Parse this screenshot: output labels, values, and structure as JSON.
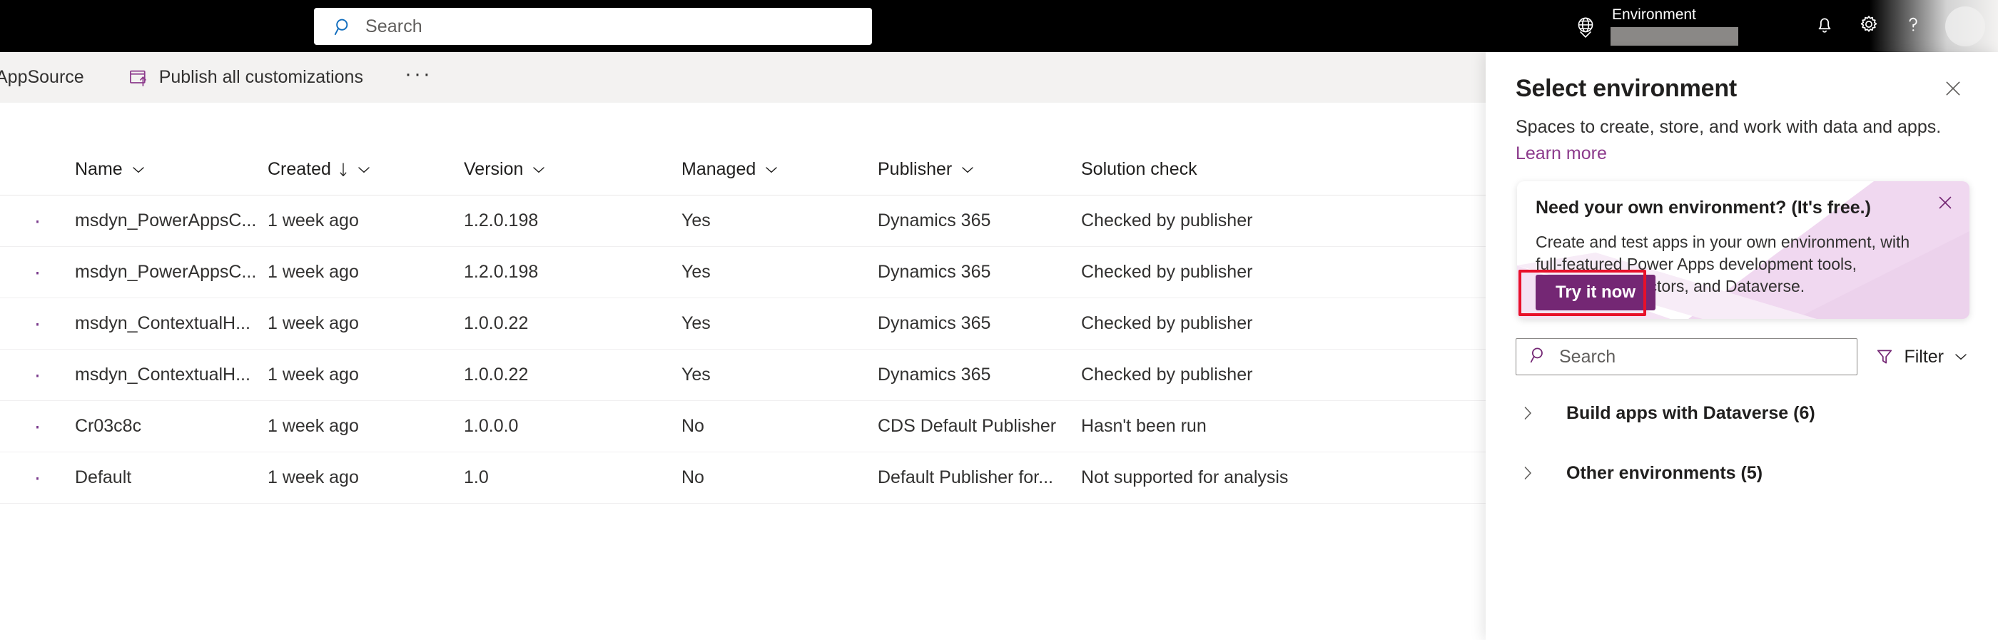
{
  "topbar": {
    "search_placeholder": "Search",
    "search_icon": "search-icon",
    "globe_icon": "globe-icon",
    "environment_label": "Environment",
    "environment_value": "",
    "notifications_icon": "bell-icon",
    "settings_icon": "gear-icon",
    "help_icon": "question-mark-icon",
    "avatar": "user-avatar"
  },
  "commandbar": {
    "appsource_label": "AppSource",
    "publish_label": "Publish all customizations",
    "publish_icon": "publish-icon",
    "overflow_label": "···"
  },
  "table": {
    "columns": [
      {
        "key": "name",
        "label": "Name",
        "chevron": true,
        "sorted": false
      },
      {
        "key": "created",
        "label": "Created",
        "chevron": true,
        "sorted": true,
        "sort_dir": "desc"
      },
      {
        "key": "version",
        "label": "Version",
        "chevron": true,
        "sorted": false
      },
      {
        "key": "managed",
        "label": "Managed",
        "chevron": true,
        "sorted": false
      },
      {
        "key": "publisher",
        "label": "Publisher",
        "chevron": true,
        "sorted": false
      },
      {
        "key": "solution_check",
        "label": "Solution check",
        "chevron": false,
        "sorted": false
      }
    ],
    "rows": [
      {
        "name": "msdyn_PowerAppsC...",
        "created": "1 week ago",
        "version": "1.2.0.198",
        "managed": "Yes",
        "publisher": "Dynamics 365",
        "solution_check": "Checked by publisher"
      },
      {
        "name": "msdyn_PowerAppsC...",
        "created": "1 week ago",
        "version": "1.2.0.198",
        "managed": "Yes",
        "publisher": "Dynamics 365",
        "solution_check": "Checked by publisher"
      },
      {
        "name": "msdyn_ContextualH...",
        "created": "1 week ago",
        "version": "1.0.0.22",
        "managed": "Yes",
        "publisher": "Dynamics 365",
        "solution_check": "Checked by publisher"
      },
      {
        "name": "msdyn_ContextualH...",
        "created": "1 week ago",
        "version": "1.0.0.22",
        "managed": "Yes",
        "publisher": "Dynamics 365",
        "solution_check": "Checked by publisher"
      },
      {
        "name": "Cr03c8c",
        "created": "1 week ago",
        "version": "1.0.0.0",
        "managed": "No",
        "publisher": "CDS Default Publisher",
        "solution_check": "Hasn't been run"
      },
      {
        "name": "Default",
        "created": "1 week ago",
        "version": "1.0",
        "managed": "No",
        "publisher": "Default Publisher for...",
        "solution_check": "Not supported for analysis"
      }
    ]
  },
  "panel": {
    "title": "Select environment",
    "subtitle": "Spaces to create, store, and work with data and apps.",
    "learn_more": "Learn more",
    "close_icon": "close-icon",
    "callout": {
      "title": "Need your own environment? (It's free.)",
      "body": "Create and test apps in your own environment, with full-featured Power Apps development tools, premium connectors, and Dataverse.",
      "cta_label": "Try it now",
      "close_icon": "close-icon"
    },
    "search_placeholder": "Search",
    "search_icon": "search-icon",
    "filter_label": "Filter",
    "filter_icon": "funnel-icon",
    "groups": [
      {
        "label": "Build apps with Dataverse (6)"
      },
      {
        "label": "Other environments (5)"
      }
    ]
  },
  "colors": {
    "topbar_bg": "#000000",
    "commandbar_bg": "#f3f2f1",
    "accent_purple": "#742774",
    "link_purple": "#8c3b8c",
    "highlight_red": "#e8102a",
    "callout_deco_pink": "#eccded"
  }
}
